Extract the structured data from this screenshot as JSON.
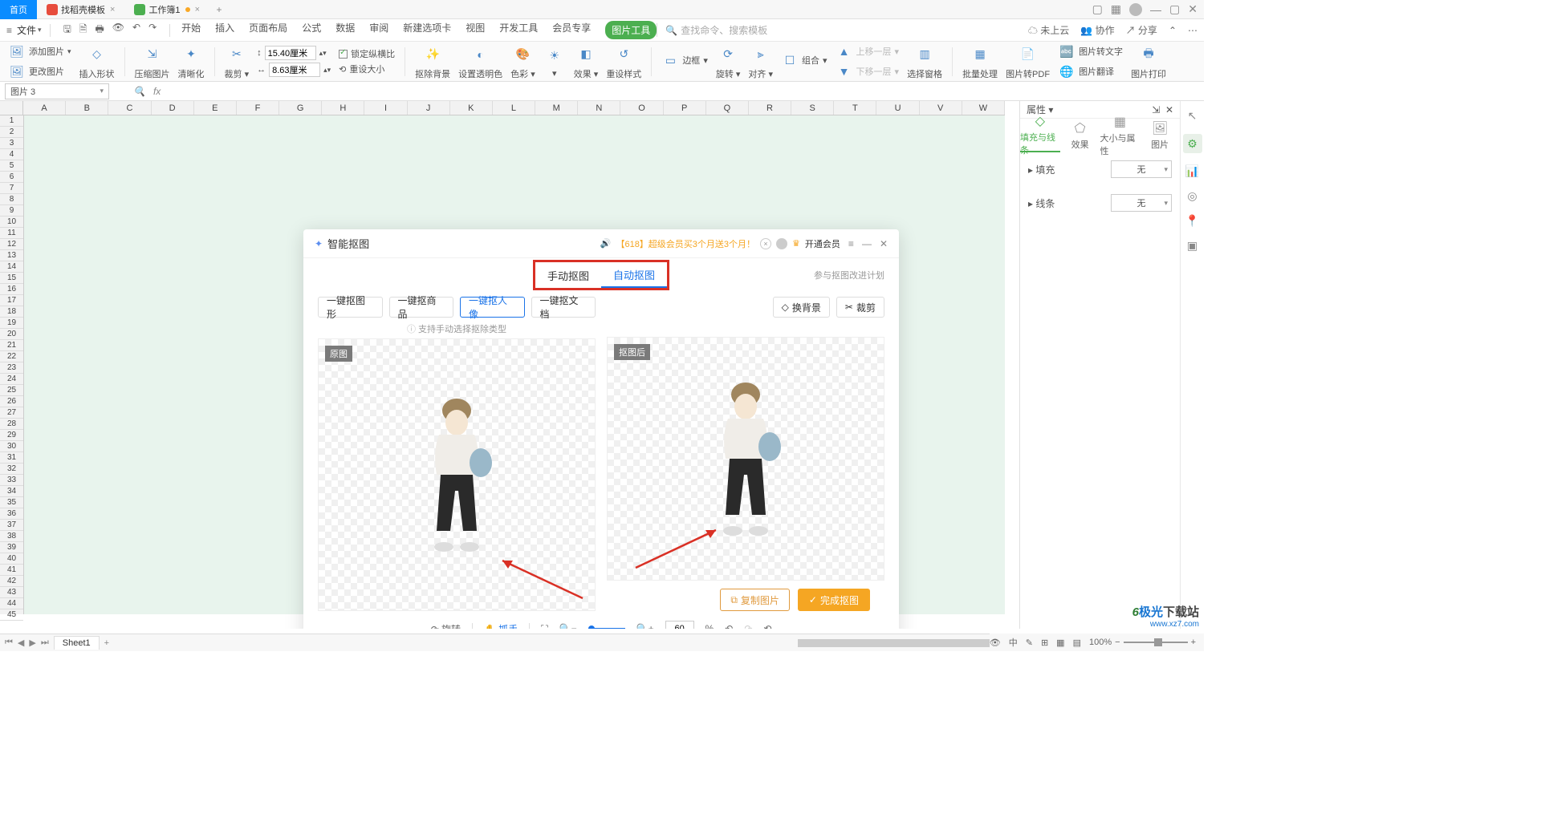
{
  "titlebar": {
    "home": "首页",
    "tab1": "找稻壳模板",
    "tab2": "工作簿1",
    "dirty": true
  },
  "menubar": {
    "file": "文件",
    "tabs": [
      "开始",
      "插入",
      "页面布局",
      "公式",
      "数据",
      "审阅",
      "新建选项卡",
      "视图",
      "开发工具",
      "会员专享",
      "图片工具"
    ],
    "search_prompt": "查找命令、搜索模板",
    "right": {
      "cloud": "未上云",
      "coop": "协作",
      "share": "分享"
    }
  },
  "ribbon": {
    "addpic": "添加图片",
    "changepic": "更改图片",
    "insertshape": "插入形状",
    "compress": "压缩图片",
    "sharpen": "清晰化",
    "crop": "裁剪",
    "size_w": "15.40厘米",
    "size_h": "8.63厘米",
    "lock": "锁定纵横比",
    "reset": "重设大小",
    "removebg": "抠除背景",
    "settrans": "设置透明色",
    "color": "色彩",
    "effect": "效果",
    "resetstyle": "重设样式",
    "border": "边框",
    "rotate": "旋转",
    "align": "对齐",
    "group": "组合",
    "up": "上移一层",
    "down": "下移一层",
    "selpane": "选择窗格",
    "batch": "批量处理",
    "topdf": "图片转PDF",
    "totext": "图片转文字",
    "translate": "图片翻译",
    "print": "图片打印"
  },
  "namebox": "图片 3",
  "columns": [
    "A",
    "B",
    "C",
    "D",
    "E",
    "F",
    "G",
    "H",
    "I",
    "J",
    "K",
    "L",
    "M",
    "N",
    "O",
    "P",
    "Q",
    "R",
    "S",
    "T",
    "U",
    "V",
    "W"
  ],
  "dialog": {
    "title": "智能抠图",
    "promo": "【618】超级会员买3个月送3个月！",
    "member": "开通会员",
    "tabs": {
      "manual": "手动抠图",
      "auto": "自动抠图"
    },
    "feedback": "参与抠图改进计划",
    "left": {
      "buttons": [
        "一键抠图形",
        "一键抠商品",
        "一键抠人像",
        "一键抠文档"
      ],
      "active_idx": 2,
      "hint": "支持手动选择抠除类型",
      "badge": "原图"
    },
    "right": {
      "buttons": {
        "bg": "换背景",
        "crop": "裁剪"
      },
      "badge": "抠图后",
      "copy": "复制图片",
      "done": "完成抠图"
    },
    "footer": {
      "rotate": "旋转",
      "grab": "抓手",
      "zoom_val": "60",
      "pct": "%"
    }
  },
  "proppanel": {
    "title": "属性",
    "tabs": [
      "填充与线条",
      "效果",
      "大小与属性",
      "图片"
    ],
    "fill": "填充",
    "line": "线条",
    "none": "无"
  },
  "sheet": {
    "name": "Sheet1"
  },
  "status": {
    "zoom": "100%"
  },
  "watermark": {
    "name": "极光下载站",
    "url": "www.xz7.com"
  }
}
